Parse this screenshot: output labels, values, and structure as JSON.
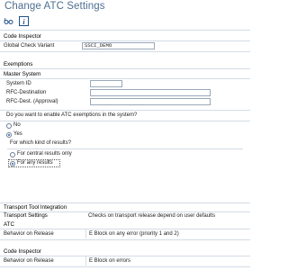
{
  "window": {
    "title": "Change ATC Settings"
  },
  "toolbar": {
    "icons": [
      "edit-glasses-icon",
      "info-icon"
    ]
  },
  "code_inspector": {
    "header": "Code Inspector",
    "global_check_variant_label": "Global Check Variant",
    "global_check_variant_value": "SSCI_DEMO"
  },
  "exemptions": {
    "header": "Exemptions",
    "master_system_header": "Master System",
    "system_id_label": "System ID",
    "system_id_value": "",
    "rfc_dest_label": "RFC-Destination",
    "rfc_dest_value": "",
    "rfc_dest_approval_label": "RFC-Dest. (Approval)",
    "rfc_dest_approval_value": "",
    "enable_question": "Do you want to enable ATC exemptions in the system?",
    "option_no": "No",
    "option_yes": "Yes",
    "selected_enable": "Yes",
    "which_results_question": "For which kind of results?",
    "option_central": "For central results only",
    "option_any": "For any results",
    "selected_results": "For any results"
  },
  "transport": {
    "header": "Transport Tool Integration",
    "settings_label": "Transport Settings",
    "settings_value": "Checks on transport release depend on user defaults",
    "atc_header": "ATC",
    "atc_behavior_label": "Behavior on Release",
    "atc_behavior_value": "E Block on any error (priority 1 and 2)",
    "ci_header": "Code Inspector",
    "ci_behavior_label": "Behavior on Release",
    "ci_behavior_value": "E Block on errors"
  }
}
